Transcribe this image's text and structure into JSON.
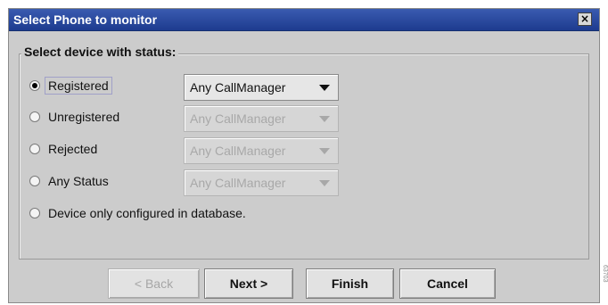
{
  "window": {
    "title": "Select Phone to monitor",
    "close_glyph": "×"
  },
  "group": {
    "legend": "Select device with status:"
  },
  "options": [
    {
      "label": "Registered",
      "checked": true,
      "combo": "Any CallManager",
      "combo_enabled": true
    },
    {
      "label": "Unregistered",
      "checked": false,
      "combo": "Any CallManager",
      "combo_enabled": false
    },
    {
      "label": "Rejected",
      "checked": false,
      "combo": "Any CallManager",
      "combo_enabled": false
    },
    {
      "label": "Any Status",
      "checked": false,
      "combo": "Any CallManager",
      "combo_enabled": false
    },
    {
      "label": "Device only configured in database.",
      "checked": false
    }
  ],
  "buttons": {
    "back": "< Back",
    "next": "Next >",
    "finish": "Finish",
    "cancel": "Cancel"
  },
  "figure_id": "63703"
}
